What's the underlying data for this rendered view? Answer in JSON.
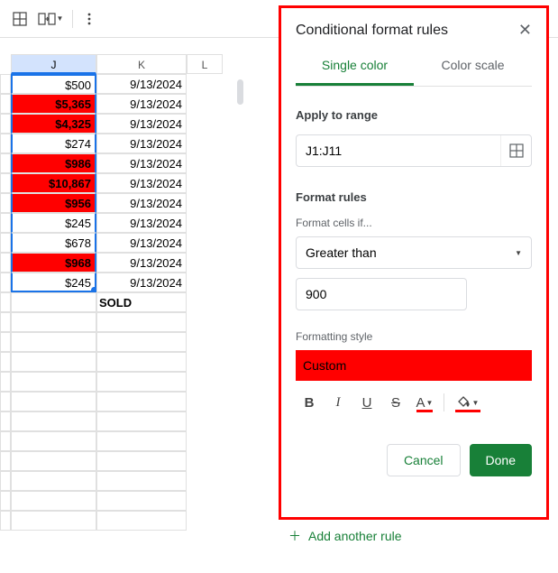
{
  "sheet": {
    "columns": [
      "J",
      "K",
      "L"
    ],
    "selected_column": "J",
    "rows": [
      {
        "j": "$500",
        "k": "9/13/2024",
        "red": false
      },
      {
        "j": "$5,365",
        "k": "9/13/2024",
        "red": true
      },
      {
        "j": "$4,325",
        "k": "9/13/2024",
        "red": true
      },
      {
        "j": "$274",
        "k": "9/13/2024",
        "red": false
      },
      {
        "j": "$986",
        "k": "9/13/2024",
        "red": true
      },
      {
        "j": "$10,867",
        "k": "9/13/2024",
        "red": true
      },
      {
        "j": "$956",
        "k": "9/13/2024",
        "red": true
      },
      {
        "j": "$245",
        "k": "9/13/2024",
        "red": false
      },
      {
        "j": "$678",
        "k": "9/13/2024",
        "red": false
      },
      {
        "j": "$968",
        "k": "9/13/2024",
        "red": true
      },
      {
        "j": "$245",
        "k": "9/13/2024",
        "red": false
      }
    ],
    "sold_label": "SOLD"
  },
  "panel": {
    "title": "Conditional format rules",
    "tabs": {
      "single": "Single color",
      "scale": "Color scale"
    },
    "apply_label": "Apply to range",
    "range": "J1:J11",
    "format_rules_label": "Format rules",
    "format_if_label": "Format cells if...",
    "condition": "Greater than",
    "value": "900",
    "style_label": "Formatting style",
    "preview_label": "Custom",
    "cancel": "Cancel",
    "done": "Done"
  },
  "add_rule": "Add another rule"
}
